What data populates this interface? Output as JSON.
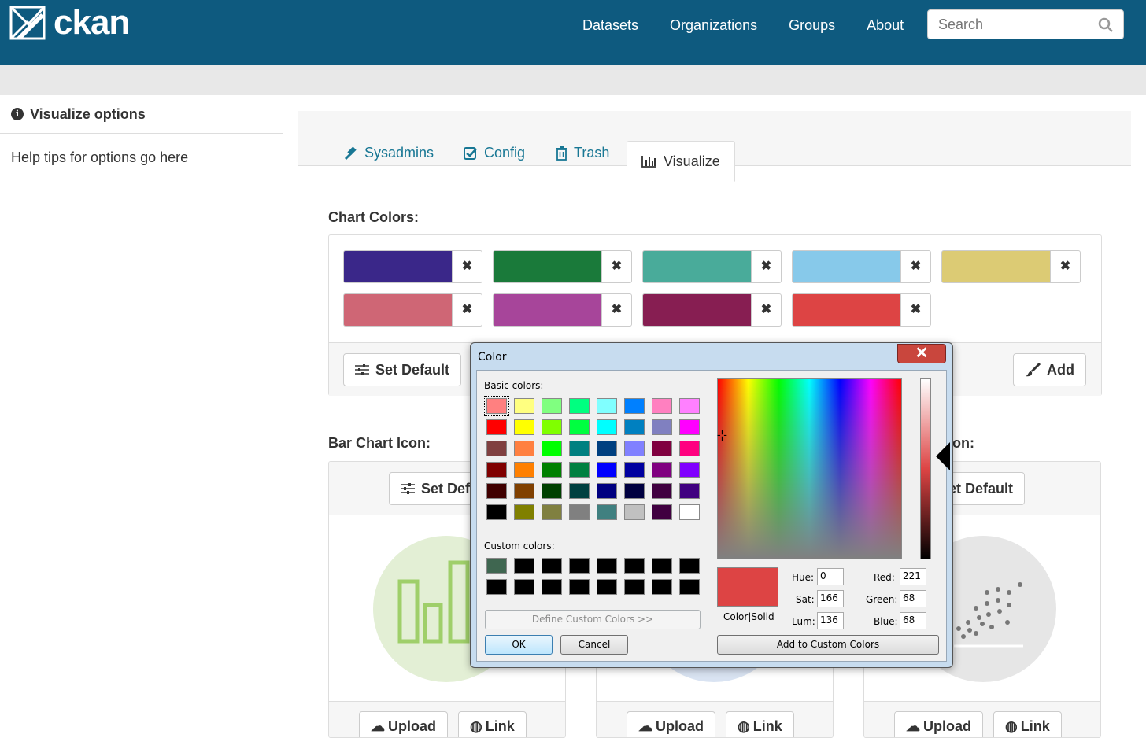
{
  "header": {
    "logo_text": "ckan",
    "nav": [
      "Datasets",
      "Organizations",
      "Groups",
      "About"
    ],
    "search_placeholder": "Search"
  },
  "sidebar": {
    "title": "Visualize options",
    "help": "Help tips for options go here"
  },
  "tabs": [
    {
      "label": "Sysadmins",
      "icon": "gavel-icon"
    },
    {
      "label": "Config",
      "icon": "check-square-icon"
    },
    {
      "label": "Trash",
      "icon": "trash-icon"
    },
    {
      "label": "Visualize",
      "icon": "bar-chart-icon",
      "active": true
    }
  ],
  "chart_colors": {
    "title": "Chart Colors:",
    "colors": [
      "#3a2789",
      "#1a7a3a",
      "#49ab9a",
      "#87c9ea",
      "#dccb74",
      "#cf6675",
      "#a7459a",
      "#871e52",
      "#dd4444"
    ],
    "remove_label": "✖",
    "set_default": "Set Default",
    "add": "Add"
  },
  "bar_chart_icon": {
    "title": "Bar Chart Icon:",
    "set_default": "Set Default"
  },
  "third_icon": {
    "title_fragment": "on:",
    "set_default": "Set Default"
  },
  "card_buttons": {
    "upload": "Upload",
    "link": "Link"
  },
  "dialog": {
    "title": "Color",
    "close": "✕",
    "basic_colors_label": "Basic colors:",
    "basic_colors": [
      "#ff8080",
      "#ffff80",
      "#80ff80",
      "#00ff80",
      "#80ffff",
      "#0080ff",
      "#ff80c0",
      "#ff80ff",
      "#ff0000",
      "#ffff00",
      "#80ff00",
      "#00ff40",
      "#00ffff",
      "#0080c0",
      "#8080c0",
      "#ff00ff",
      "#804040",
      "#ff8040",
      "#00ff00",
      "#008080",
      "#004080",
      "#8080ff",
      "#800040",
      "#ff0080",
      "#800000",
      "#ff8000",
      "#008000",
      "#008040",
      "#0000ff",
      "#0000a0",
      "#800080",
      "#8000ff",
      "#400000",
      "#804000",
      "#004000",
      "#004040",
      "#000080",
      "#000040",
      "#400040",
      "#400080",
      "#000000",
      "#808000",
      "#808040",
      "#808080",
      "#408080",
      "#c0c0c0",
      "#400040",
      "#ffffff"
    ],
    "custom_colors_label": "Custom colors:",
    "custom_colors": [
      "#3f6650",
      "#000000",
      "#000000",
      "#000000",
      "#000000",
      "#000000",
      "#000000",
      "#000000",
      "#000000",
      "#000000",
      "#000000",
      "#000000",
      "#000000",
      "#000000",
      "#000000",
      "#000000"
    ],
    "define_custom": "Define Custom Colors >>",
    "ok": "OK",
    "cancel": "Cancel",
    "color_solid": "Color|Solid",
    "hue_label": "Hue:",
    "hue": "0",
    "sat_label": "Sat:",
    "sat": "166",
    "lum_label": "Lum:",
    "lum": "136",
    "red_label": "Red:",
    "red": "221",
    "green_label": "Green:",
    "green": "68",
    "blue_label": "Blue:",
    "blue": "68",
    "add_custom": "Add to Custom Colors"
  }
}
